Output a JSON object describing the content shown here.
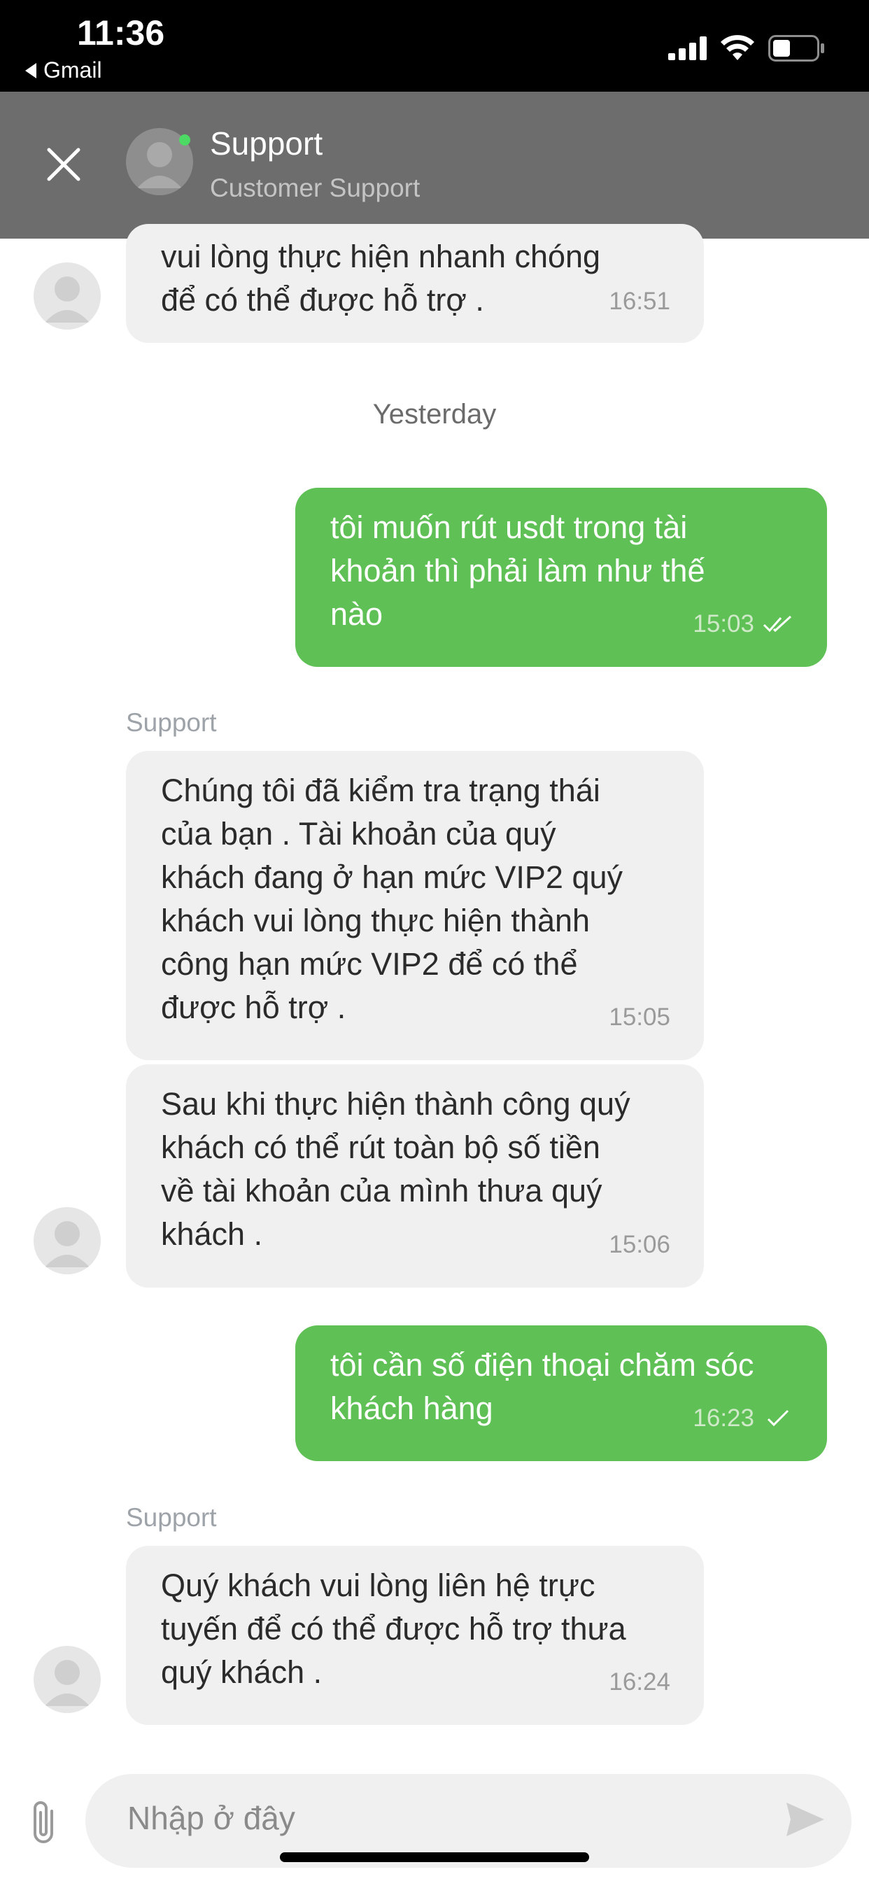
{
  "status_bar": {
    "time": "11:36",
    "back_app": "Gmail",
    "signal_icon": "cellular-signal-icon",
    "wifi_icon": "wifi-icon",
    "battery_icon": "battery-icon"
  },
  "header": {
    "title": "Support",
    "subtitle": "Customer Support",
    "close_icon": "close-icon",
    "online_color": "#4cd964"
  },
  "messages": [
    {
      "direction": "in",
      "lines": [
        "vui lòng thực hiện nhanh chóng",
        "để có thể được hỗ trợ ."
      ],
      "time": "16:51"
    },
    {
      "direction": "out",
      "lines": [
        "tôi muốn rút usdt trong tài",
        "khoản thì phải làm như thế",
        "nào"
      ],
      "time": "15:03",
      "status": "read"
    },
    {
      "direction": "in",
      "sender": "Support",
      "lines": [
        "Chúng tôi đã kiểm tra trạng thái",
        "của bạn . Tài khoản của quý",
        "khách đang ở hạn mức VIP2 quý",
        "khách vui lòng thực hiện thành",
        "công hạn mức VIP2 để có thể",
        "được hỗ trợ ."
      ],
      "time": "15:05"
    },
    {
      "direction": "in",
      "lines": [
        "Sau khi thực hiện thành công quý",
        "khách có thể rút toàn bộ số tiền",
        "về tài khoản của mình thưa quý",
        "khách ."
      ],
      "time": "15:06"
    },
    {
      "direction": "out",
      "lines": [
        "tôi cần số điện thoại chăm sóc",
        "khách hàng"
      ],
      "time": "16:23",
      "status": "sent"
    },
    {
      "direction": "in",
      "sender": "Support",
      "lines": [
        "Quý khách vui lòng liên hệ trực",
        "tuyến để có thể được hỗ trợ thưa",
        "quý khách ."
      ],
      "time": "16:24"
    }
  ],
  "date_separator": "Yesterday",
  "composer": {
    "placeholder": "Nhập ở đây",
    "attach_icon": "paperclip-icon",
    "send_icon": "send-icon"
  },
  "colors": {
    "outgoing_bubble": "#5fc055",
    "incoming_bubble": "#f0f0f1",
    "header_bg": "#6d6d6d"
  }
}
